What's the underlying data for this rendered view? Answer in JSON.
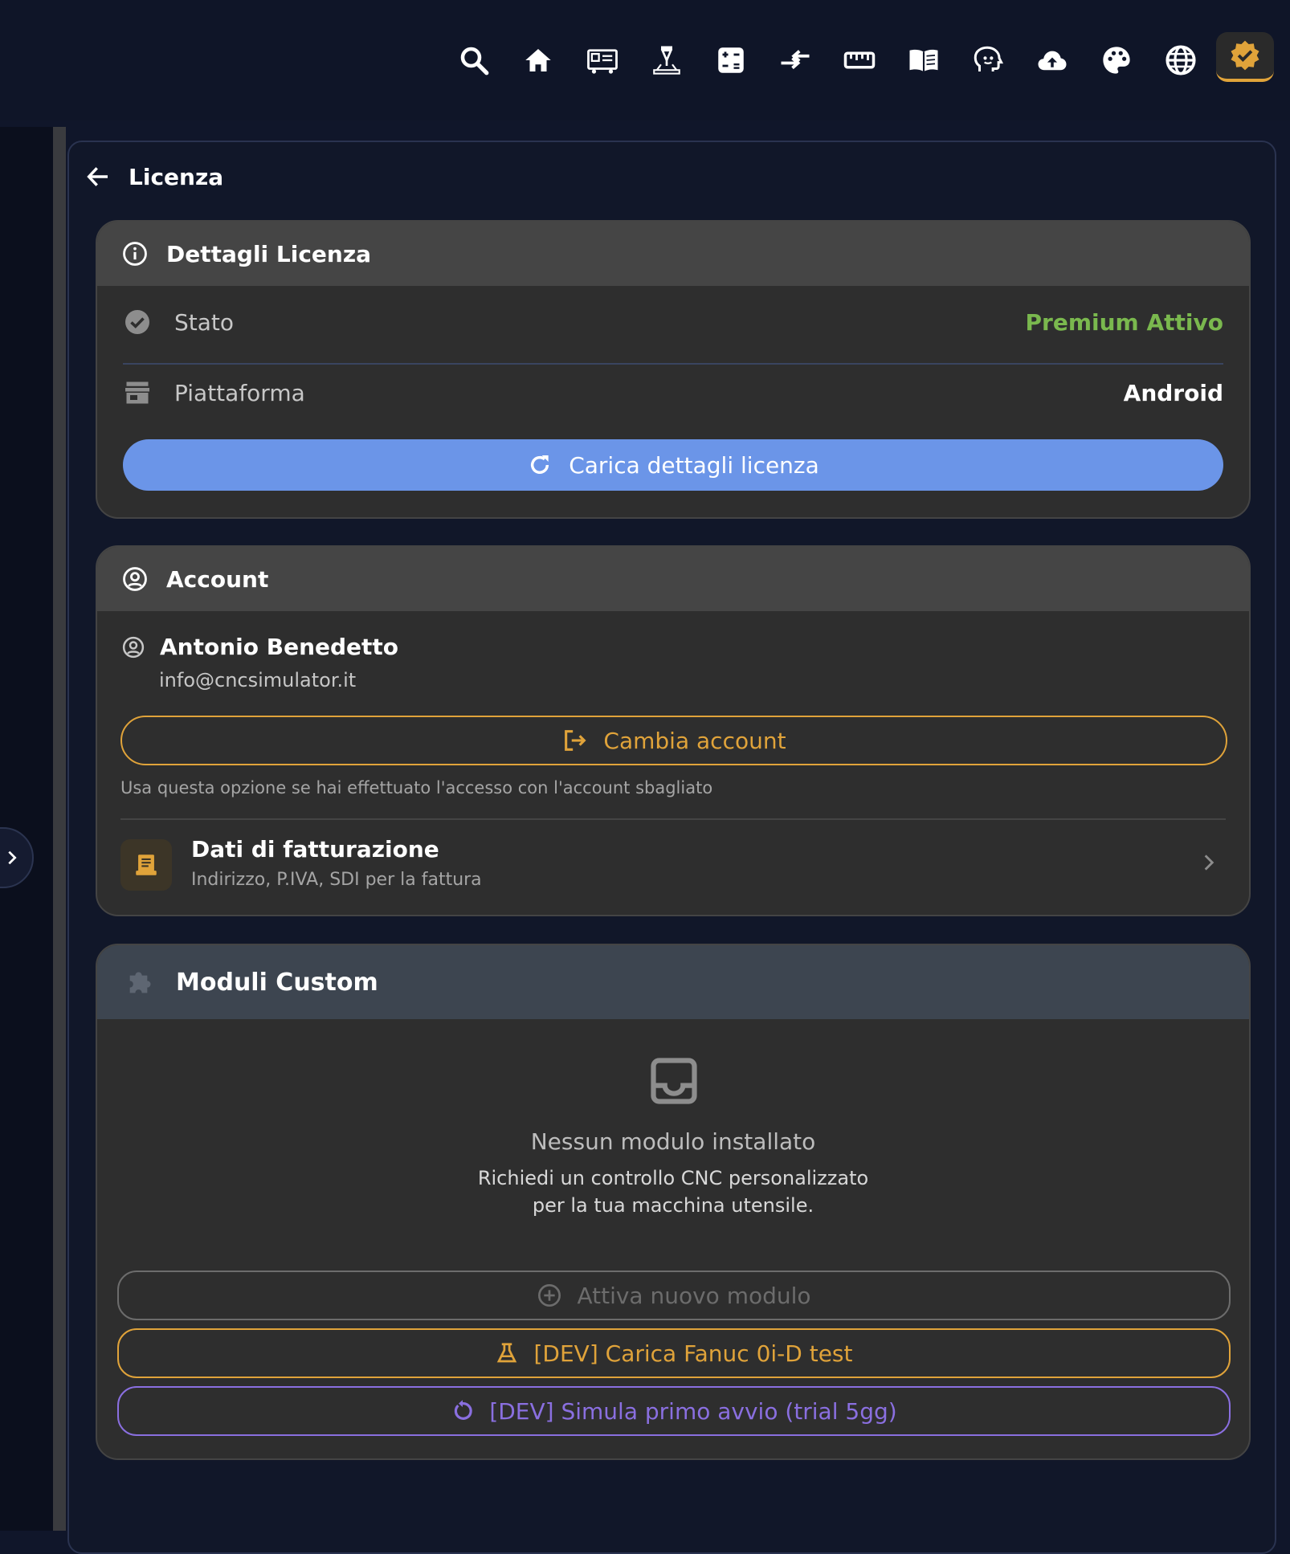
{
  "topbar": {
    "icons": [
      "search-icon",
      "home-icon",
      "machine-icon",
      "laser-icon",
      "calculator-icon",
      "convert-icon",
      "ruler-icon",
      "book-icon",
      "ai-assistant-icon",
      "cloud-upload-icon",
      "palette-icon",
      "globe-icon",
      "license-badge-icon"
    ],
    "active": "license-badge-icon"
  },
  "page": {
    "title": "Licenza"
  },
  "license_card": {
    "title": "Dettagli Licenza",
    "status_label": "Stato",
    "status_value": "Premium Attivo",
    "platform_label": "Piattaforma",
    "platform_value": "Android",
    "reload_button": "Carica dettagli licenza"
  },
  "account_card": {
    "title": "Account",
    "user_name": "Antonio Benedetto",
    "user_email": "info@cncsimulator.it",
    "switch_button": "Cambia account",
    "switch_hint": "Usa questa opzione se hai effettuato l'accesso con l'account sbagliato",
    "billing_title": "Dati di fatturazione",
    "billing_subtitle": "Indirizzo, P.IVA, SDI per la fattura"
  },
  "modules_card": {
    "title": "Moduli Custom",
    "empty_title": "Nessun modulo installato",
    "empty_line1": "Richiedi un controllo CNC personalizzato",
    "empty_line2": "per la tua macchina utensile.",
    "activate_button": "Attiva nuovo modulo",
    "dev_fanuc_button": "[DEV] Carica Fanuc 0i-D test",
    "dev_trial_button": "[DEV] Simula primo avvio (trial 5gg)"
  },
  "colors": {
    "accent_blue": "#6b95e8",
    "status_green": "#7ab84e",
    "orange": "#e0a33a",
    "purple": "#8a6fe0",
    "muted_gray": "#6c6c6c"
  }
}
